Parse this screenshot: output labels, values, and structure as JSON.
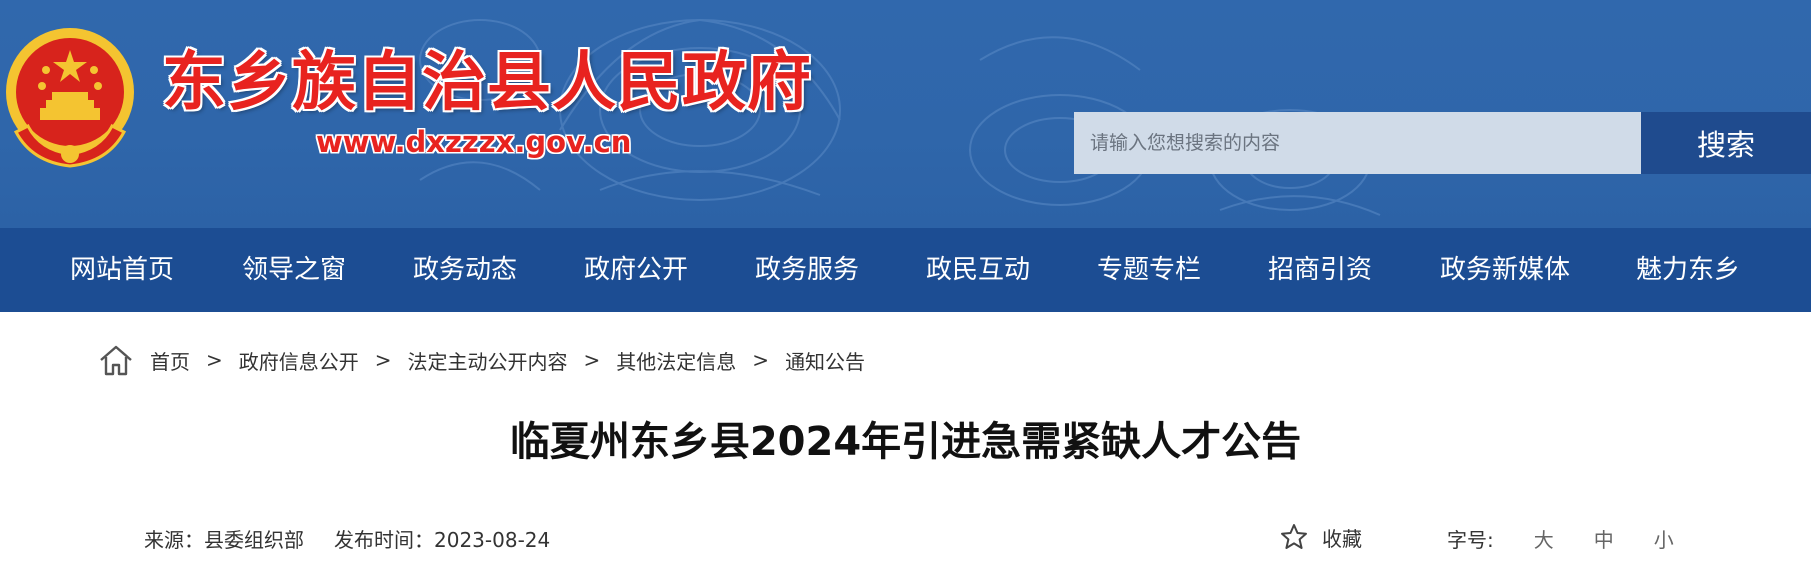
{
  "header": {
    "site_title": "东乡族自治县人民政府",
    "site_url": "www.dxzzzx.gov.cn",
    "search_placeholder": "请输入您想搜索的内容",
    "search_button": "搜索"
  },
  "nav": {
    "items": [
      "网站首页",
      "领导之窗",
      "政务动态",
      "政府公开",
      "政务服务",
      "政民互动",
      "专题专栏",
      "招商引资",
      "政务新媒体",
      "魅力东乡"
    ]
  },
  "breadcrumb": {
    "items": [
      "首页",
      "政府信息公开",
      "法定主动公开内容",
      "其他法定信息",
      "通知公告"
    ],
    "separator": ">"
  },
  "article": {
    "title": "临夏州东乡县2024年引进急需紧缺人才公告",
    "source": "来源：县委组织部",
    "publish_time": "发布时间：2023-08-24",
    "favorite": "收藏",
    "font_size_label": "字号:",
    "font_sizes": [
      "大",
      "中",
      "小"
    ]
  },
  "colors": {
    "banner_blue": "#3068ad",
    "nav_blue": "#1c4d93",
    "search_button": "#1f4b8e",
    "title_red": "#e8231f"
  }
}
